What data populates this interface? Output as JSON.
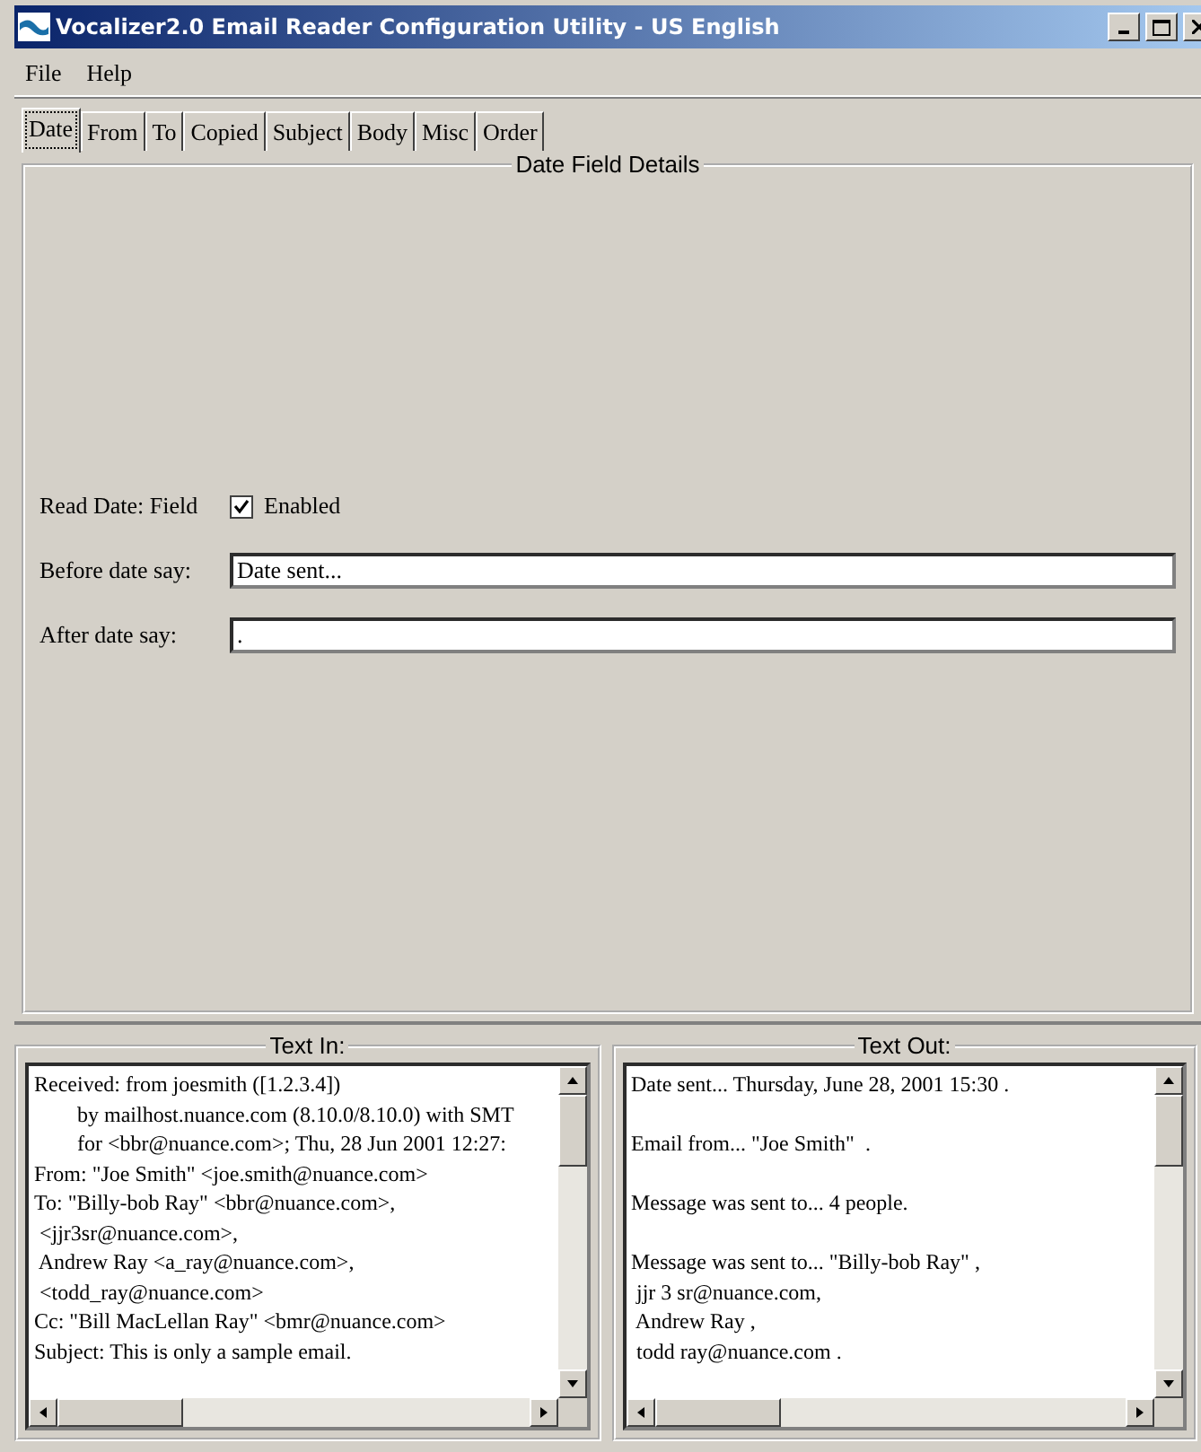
{
  "window": {
    "title": "Vocalizer2.0 Email Reader Configuration Utility - US English"
  },
  "menu": [
    "File",
    "Help"
  ],
  "tabs": [
    {
      "label": "Date",
      "selected": true
    },
    {
      "label": "From",
      "selected": false
    },
    {
      "label": "To",
      "selected": false
    },
    {
      "label": "Copied",
      "selected": false
    },
    {
      "label": "Subject",
      "selected": false
    },
    {
      "label": "Body",
      "selected": false
    },
    {
      "label": "Misc",
      "selected": false
    },
    {
      "label": "Order",
      "selected": false
    }
  ],
  "details": {
    "title": "Date Field Details",
    "read_label": "Read Date: Field",
    "enabled": {
      "label": "Enabled",
      "checked": true
    },
    "fields": [
      {
        "label": "Before date say:",
        "value": "Date sent..."
      },
      {
        "label": "After date say:",
        "value": "."
      }
    ]
  },
  "text_in": {
    "title": "Text In:",
    "lines": [
      "Received: from joesmith ([1.2.3.4])",
      "        by mailhost.nuance.com (8.10.0/8.10.0) with SMT",
      "        for <bbr@nuance.com>; Thu, 28 Jun 2001 12:27:",
      "From: \"Joe Smith\" <joe.smith@nuance.com>",
      "To: \"Billy-bob Ray\" <bbr@nuance.com>,",
      " <jjr3sr@nuance.com>,",
      " Andrew Ray <a_ray@nuance.com>,",
      " <todd_ray@nuance.com>",
      "Cc: \"Bill MacLellan Ray\" <bmr@nuance.com>",
      "Subject: This is only a sample email."
    ]
  },
  "text_out": {
    "title": "Text Out:",
    "paragraphs": [
      [
        "Date sent... Thursday, June 28, 2001 15:30 ."
      ],
      [
        "Email from... \"Joe Smith\"  ."
      ],
      [
        "Message was sent to... 4 people."
      ],
      [
        "Message was sent to... \"Billy-bob Ray\" ,",
        " jjr 3 sr@nuance.com,",
        " Andrew Ray ,",
        " todd ray@nuance.com ."
      ]
    ]
  }
}
